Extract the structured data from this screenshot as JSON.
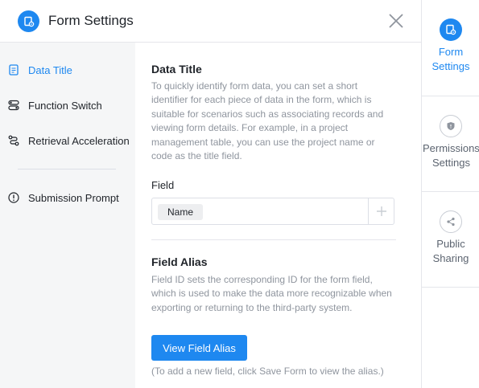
{
  "header": {
    "title": "Form Settings",
    "icon": "form-settings-icon",
    "close_icon": "close-icon",
    "accent": "#1e88f0"
  },
  "nav": {
    "items": [
      {
        "label": "Data Title",
        "icon": "document-icon",
        "active": true
      },
      {
        "label": "Function Switch",
        "icon": "toggle-icon",
        "active": false
      },
      {
        "label": "Retrieval Acceleration",
        "icon": "route-icon",
        "active": false
      },
      {
        "label": "Submission Prompt",
        "icon": "info-icon",
        "active": false
      }
    ]
  },
  "content": {
    "data_title": {
      "title": "Data Title",
      "desc_lines": [
        "To quickly identify form data, you can set a short",
        "identifier for each piece of data in the form, which is",
        "suitable for scenarios such as associating records and",
        "viewing form details. For example, in a project",
        "management table, you can use the project name or",
        "code as the title field."
      ],
      "field_label": "Field",
      "field_tag": "Name",
      "add_icon": "plus-icon"
    },
    "field_alias": {
      "title": "Field Alias",
      "desc_lines": [
        "Field ID sets the corresponding ID for the form field,",
        "which is used to make the data more recognizable when",
        "exporting or returning to the third-party system."
      ],
      "button_label": "View Field Alias",
      "hint": "(To add a new field, click Save Form to view the alias.)"
    }
  },
  "right_panel": {
    "items": [
      {
        "label_lines": [
          "Form",
          "Settings"
        ],
        "icon": "form-settings-icon",
        "active": true
      },
      {
        "label_lines": [
          "Permissions",
          "Settings"
        ],
        "icon": "shield-icon",
        "active": false
      },
      {
        "label_lines": [
          "Public",
          "Sharing"
        ],
        "icon": "share-icon",
        "active": false
      }
    ]
  }
}
